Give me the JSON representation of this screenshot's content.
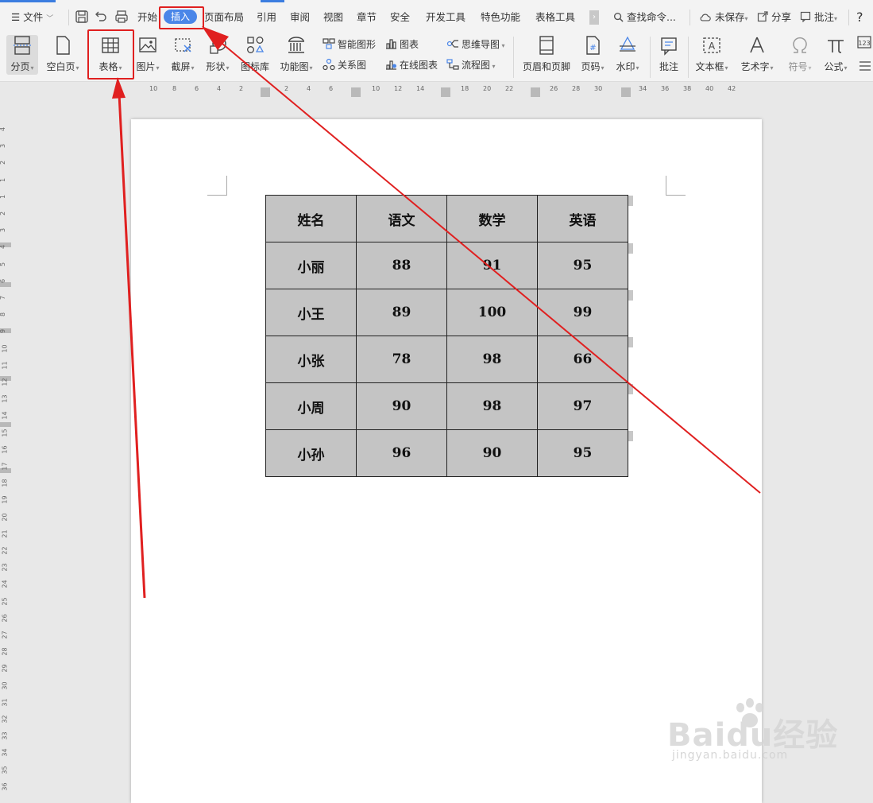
{
  "app": {
    "file_menu": "文件",
    "tabs": [
      "开始",
      "插入",
      "页面布局",
      "引用",
      "审阅",
      "视图",
      "章节",
      "安全",
      "开发工具",
      "特色功能",
      "表格工具"
    ],
    "active_tab": "插入",
    "search_placeholder": "查找命令...",
    "right_actions": {
      "unsaved": "未保存",
      "share": "分享",
      "comment": "批注",
      "help": "?"
    },
    "scroll_tabs_glyph": "›"
  },
  "ribbon": {
    "page_break": "分页",
    "blank_page": "空白页",
    "table": "表格",
    "picture": "图片",
    "screenshot": "截屏",
    "shapes": "形状",
    "icon_library": "图标库",
    "function_chart": "功能图",
    "smart_graphic": "智能图形",
    "chart": "图表",
    "mind_map": "思维导图",
    "relation_chart": "关系图",
    "online_chart": "在线图表",
    "flowchart": "流程图",
    "header_footer": "页眉和页脚",
    "page_number": "页码",
    "watermark": "水印",
    "comment": "批注",
    "text_box": "文本框",
    "word_art": "艺术字",
    "symbol": "符号",
    "formula": "公式"
  },
  "ruler": {
    "horizontal_ticks": [
      "10",
      "8",
      "6",
      "4",
      "2",
      "2",
      "4",
      "6",
      "10",
      "12",
      "14",
      "18",
      "20",
      "22",
      "26",
      "28",
      "30",
      "34",
      "36",
      "38",
      "40",
      "42"
    ],
    "vertical_ticks": [
      "4",
      "3",
      "2",
      "1",
      "1",
      "2",
      "3",
      "4",
      "5",
      "6",
      "7",
      "8",
      "9",
      "10",
      "11",
      "12",
      "13",
      "14",
      "15",
      "16",
      "17",
      "18",
      "19",
      "20",
      "21",
      "22",
      "23",
      "24",
      "25",
      "26",
      "27",
      "28",
      "29",
      "30",
      "31",
      "32",
      "33",
      "34",
      "35",
      "36"
    ]
  },
  "table": {
    "headers": [
      "姓名",
      "语文",
      "数学",
      "英语"
    ],
    "rows": [
      [
        "小丽",
        "88",
        "91",
        "95"
      ],
      [
        "小王",
        "89",
        "100",
        "99"
      ],
      [
        "小张",
        "78",
        "98",
        "66"
      ],
      [
        "小周",
        "90",
        "98",
        "97"
      ],
      [
        "小孙",
        "96",
        "90",
        "95"
      ]
    ]
  },
  "watermark": {
    "brand": "Baidu经验",
    "url": "jingyan.baidu.com"
  },
  "colors": {
    "accent": "#4a86e8",
    "annotation_red": "#e02020",
    "table_fill": "#c4c4c4"
  }
}
